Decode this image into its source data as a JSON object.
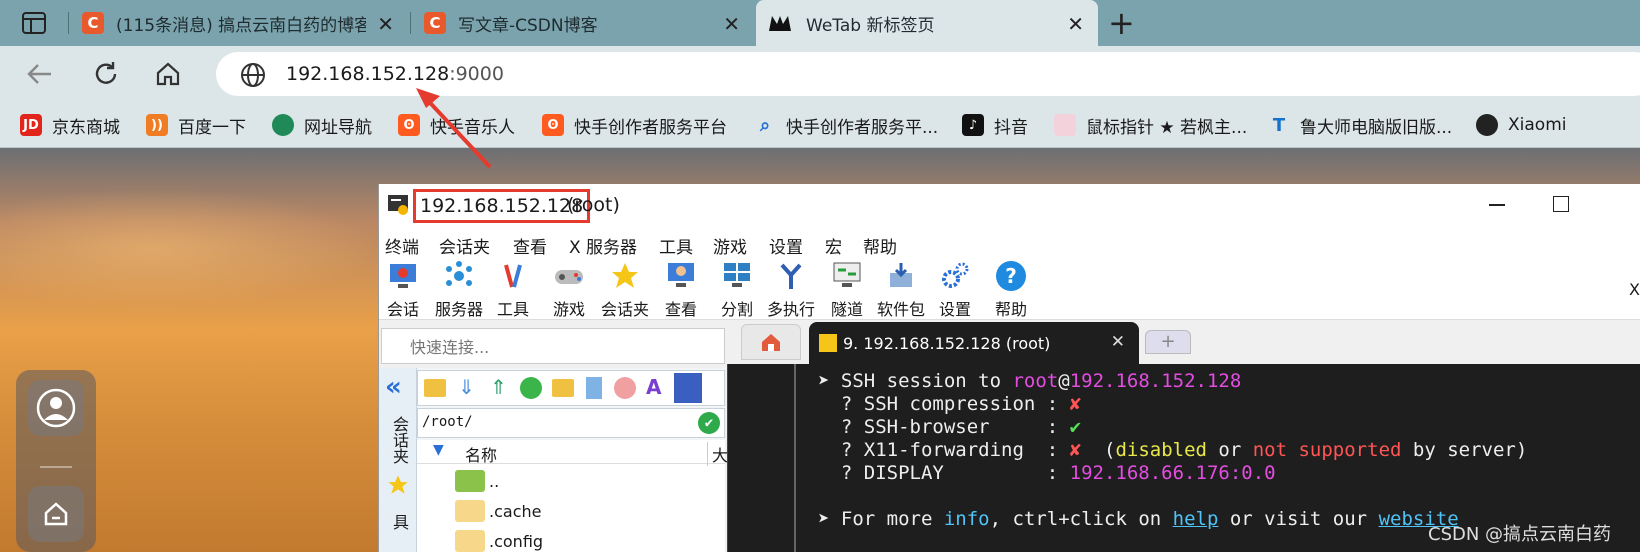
{
  "browser": {
    "tabs": [
      {
        "title": "(115条消息) 搞点云南白药的博客",
        "icon": "csdn-icon"
      },
      {
        "title": "写文章-CSDN博客",
        "icon": "csdn-icon"
      },
      {
        "title": "WeTab 新标签页",
        "icon": "wetab-icon"
      }
    ],
    "close": "✕",
    "new_tab": "+",
    "url_host": "192.168.152.128",
    "url_port": ":9000",
    "bookmarks": [
      {
        "label": "京东商城",
        "icon": "jd-icon"
      },
      {
        "label": "百度一下",
        "icon": "rss-icon"
      },
      {
        "label": "网址导航",
        "icon": "nav-icon"
      },
      {
        "label": "快手音乐人",
        "icon": "kuaishou-icon"
      },
      {
        "label": "快手创作者服务平台",
        "icon": "kuaishou-icon"
      },
      {
        "label": "快手创作者服务平...",
        "icon": "search-icon"
      },
      {
        "label": "抖音",
        "icon": "tiktok-icon"
      },
      {
        "label": "鼠标指针 ★ 若枫主...",
        "icon": "cursor-icon"
      },
      {
        "label": "鲁大师电脑版旧版...",
        "icon": "ludashi-icon"
      },
      {
        "label": "Xiaomi",
        "icon": "xiaomi-icon"
      }
    ]
  },
  "mobaxterm": {
    "title_host": "192.168.152.128",
    "title_user": "(root)",
    "menu": [
      "终端",
      "会话夹",
      "查看",
      "X 服务器",
      "工具",
      "游戏",
      "设置",
      "宏",
      "帮助"
    ],
    "toolbar": [
      "会话",
      "服务器",
      "工具",
      "游戏",
      "会话夹",
      "查看",
      "分割",
      "多执行",
      "隧道",
      "软件包",
      "设置",
      "帮助"
    ],
    "quick_connect_placeholder": "快速连接...",
    "side_tab_label": "会话夹",
    "side_tab_label2": "具",
    "path": "/root/",
    "file_header": "名称",
    "file_header2": "大",
    "files": [
      "..",
      ".cache",
      ".config"
    ],
    "ssh_tab": "9. 192.168.152.128 (root)",
    "x_label": "X"
  },
  "terminal": {
    "l1a": "➤ SSH session to ",
    "l1b": "root",
    "l1c": "@",
    "l1d": "192.168.152.128",
    "l2a": "  ? SSH compression : ",
    "l2b": "✘",
    "l3a": "  ? SSH-browser     : ",
    "l3b": "✔",
    "l4a": "  ? X11-forwarding  : ",
    "l4b": "✘",
    "l4c": "  (",
    "l4d": "disabled",
    "l4e": " or ",
    "l4f": "not supported",
    "l4g": " by server)",
    "l5a": "  ? DISPLAY         : ",
    "l5b": "192.168.66.176:0.0",
    "l6a": "➤ For more ",
    "l6b": "info",
    "l6c": ", ctrl+click on ",
    "l6d": "help",
    "l6e": " or visit our ",
    "l6f": "website"
  },
  "watermark": "CSDN @搞点云南白药",
  "colors": {
    "highlight": "#e53a2e",
    "magenta": "#e24de0",
    "yellow": "#e8e84a",
    "red": "#ff5555",
    "cyan": "#4fc3f7",
    "green": "#55e055"
  }
}
